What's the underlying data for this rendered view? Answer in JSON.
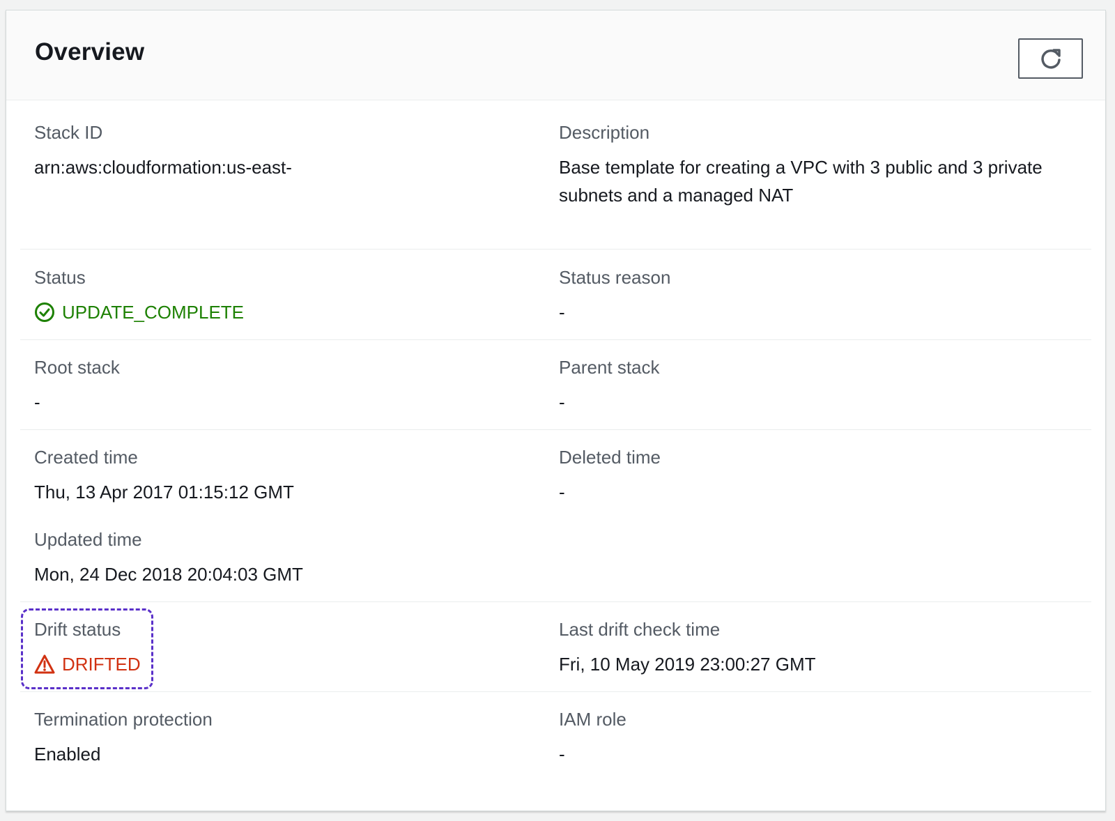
{
  "panel": {
    "title": "Overview",
    "refresh_icon": "refresh-icon"
  },
  "fields": {
    "stack_id": {
      "label": "Stack ID",
      "value": "arn:aws:cloudformation:us-east-"
    },
    "description": {
      "label": "Description",
      "value": "Base template for creating a VPC with 3 public and 3 private subnets and a managed NAT"
    },
    "status": {
      "label": "Status",
      "value": "UPDATE_COMPLETE",
      "icon": "check-circle-icon",
      "color": "#1d8102"
    },
    "status_reason": {
      "label": "Status reason",
      "value": "-"
    },
    "root_stack": {
      "label": "Root stack",
      "value": "-"
    },
    "parent_stack": {
      "label": "Parent stack",
      "value": "-"
    },
    "created_time": {
      "label": "Created time",
      "value": "Thu, 13 Apr 2017 01:15:12 GMT"
    },
    "deleted_time": {
      "label": "Deleted time",
      "value": "-"
    },
    "updated_time": {
      "label": "Updated time",
      "value": "Mon, 24 Dec 2018 20:04:03 GMT"
    },
    "drift_status": {
      "label": "Drift status",
      "value": "DRIFTED",
      "icon": "warning-triangle-icon",
      "color": "#d13212"
    },
    "last_drift_check_time": {
      "label": "Last drift check time",
      "value": "Fri, 10 May 2019 23:00:27 GMT"
    },
    "termination_protection": {
      "label": "Termination protection",
      "value": "Enabled"
    },
    "iam_role": {
      "label": "IAM role",
      "value": "-"
    }
  },
  "colors": {
    "highlight_border": "#5a30c9",
    "label_text": "#545b64",
    "value_text": "#16191f"
  }
}
